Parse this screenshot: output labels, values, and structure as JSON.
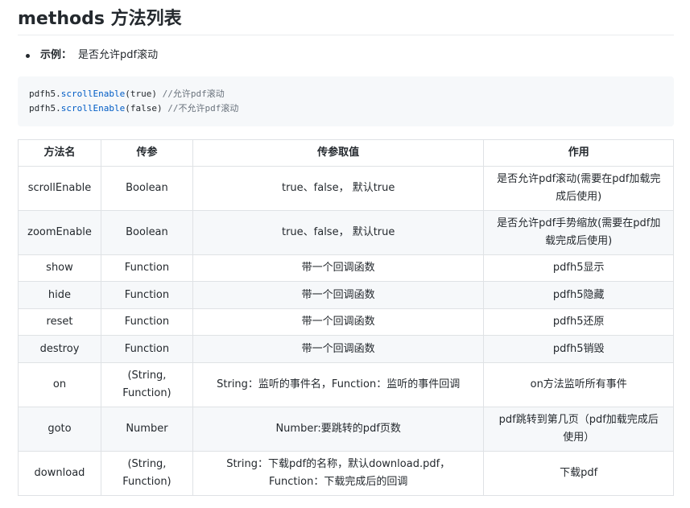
{
  "heading": {
    "title_latin": "methods",
    "title_cjk": "方法列表"
  },
  "example": {
    "label": "示例：",
    "text": "是否允许pdf滚动"
  },
  "code": {
    "lines": [
      {
        "obj": "pdfh5.",
        "method": "scrollEnable",
        "args": "(true)",
        "comment": " //允许pdf滚动"
      },
      {
        "obj": "pdfh5.",
        "method": "scrollEnable",
        "args": "(false)",
        "comment": " //不允许pdf滚动"
      }
    ]
  },
  "table": {
    "headers": [
      "方法名",
      "传参",
      "传参取值",
      "作用"
    ],
    "rows": [
      {
        "name": "scrollEnable",
        "param": "Boolean",
        "value": "true、false， 默认true",
        "effect": "是否允许pdf滚动(需要在pdf加载完成后使用)"
      },
      {
        "name": "zoomEnable",
        "param": "Boolean",
        "value": "true、false， 默认true",
        "effect": "是否允许pdf手势缩放(需要在pdf加载完成后使用)"
      },
      {
        "name": "show",
        "param": "Function",
        "value": "带一个回调函数",
        "effect": "pdfh5显示"
      },
      {
        "name": "hide",
        "param": "Function",
        "value": "带一个回调函数",
        "effect": "pdfh5隐藏"
      },
      {
        "name": "reset",
        "param": "Function",
        "value": "带一个回调函数",
        "effect": "pdfh5还原"
      },
      {
        "name": "destroy",
        "param": "Function",
        "value": "带一个回调函数",
        "effect": "pdfh5销毁"
      },
      {
        "name": "on",
        "param": "(String, Function)",
        "value": "String：监听的事件名，Function：监听的事件回调",
        "effect": "on方法监听所有事件"
      },
      {
        "name": "goto",
        "param": "Number",
        "value": "Number:要跳转的pdf页数",
        "effect": "pdf跳转到第几页（pdf加载完成后使用）"
      },
      {
        "name": "download",
        "param": "(String, Function)",
        "value": "String：下载pdf的名称，默认download.pdf，Function：下载完成后的回调",
        "effect": "下载pdf"
      }
    ]
  }
}
